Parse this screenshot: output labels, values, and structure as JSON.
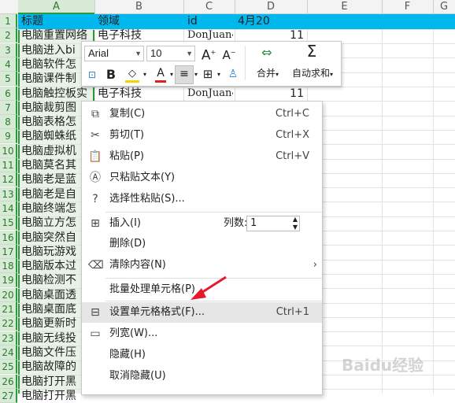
{
  "columns": [
    "A",
    "B",
    "C",
    "D",
    "E",
    "F",
    "G"
  ],
  "header_row": {
    "A": "标题",
    "B": "领域",
    "C": "id",
    "D": "4月20"
  },
  "rows": [
    {
      "n": "1"
    },
    {
      "n": "2",
      "a": "电脑重置网络",
      "b": "电子科技",
      "c": "DonJuan4",
      "d": "11"
    },
    {
      "n": "3",
      "a": "电脑进入bi"
    },
    {
      "n": "4",
      "a": "电脑软件怎"
    },
    {
      "n": "5",
      "a": "电脑课件制"
    },
    {
      "n": "6",
      "a": "电脑触控板实",
      "b": "电子科技",
      "c": "DonJuan4",
      "d": "11"
    },
    {
      "n": "7",
      "a": "电脑裁剪图"
    },
    {
      "n": "8",
      "a": "电脑表格怎"
    },
    {
      "n": "9",
      "a": "电脑蜘蛛纸"
    },
    {
      "n": "10",
      "a": "电脑虚拟机"
    },
    {
      "n": "11",
      "a": "电脑莫名其"
    },
    {
      "n": "12",
      "a": "电脑老是蓝"
    },
    {
      "n": "13",
      "a": "电脑老是自"
    },
    {
      "n": "14",
      "a": "电脑终端怎"
    },
    {
      "n": "15",
      "a": "电脑立方怎"
    },
    {
      "n": "16",
      "a": "电脑突然自"
    },
    {
      "n": "17",
      "a": "电脑玩游戏"
    },
    {
      "n": "18",
      "a": "电脑版本过"
    },
    {
      "n": "19",
      "a": "电脑检测不"
    },
    {
      "n": "20",
      "a": "电脑桌面透"
    },
    {
      "n": "21",
      "a": "电脑桌面底"
    },
    {
      "n": "22",
      "a": "电脑更新时"
    },
    {
      "n": "23",
      "a": "电脑无线投"
    },
    {
      "n": "24",
      "a": "电脑文件压"
    },
    {
      "n": "25",
      "a": "电脑故障的"
    },
    {
      "n": "26",
      "a": "电脑打开黑"
    },
    {
      "n": "27",
      "a": "电脑打开黑"
    }
  ],
  "mini_toolbar": {
    "font_name": "Arial",
    "font_size": "10",
    "grow_font": "A",
    "shrink_font": "A",
    "bold": "B",
    "fill_a": "A",
    "font_color_a": "A",
    "merge_label": "合并",
    "autosum_label": "自动求和"
  },
  "menu": {
    "copy": {
      "label": "复制(C)",
      "shortcut": "Ctrl+C"
    },
    "cut": {
      "label": "剪切(T)",
      "shortcut": "Ctrl+X"
    },
    "paste": {
      "label": "粘贴(P)",
      "shortcut": "Ctrl+V"
    },
    "paste_text": {
      "label": "只粘贴文本(Y)"
    },
    "paste_special": {
      "label": "选择性粘贴(S)..."
    },
    "insert": {
      "label": "插入(I)",
      "cols_label": "列数:",
      "cols_value": "1"
    },
    "delete": {
      "label": "删除(D)"
    },
    "clear": {
      "label": "清除内容(N)",
      "arrow": "›"
    },
    "batch": {
      "label": "批量处理单元格(P)"
    },
    "format": {
      "label": "设置单元格格式(F)...",
      "shortcut": "Ctrl+1"
    },
    "width": {
      "label": "列宽(W)..."
    },
    "hide": {
      "label": "隐藏(H)"
    },
    "unhide": {
      "label": "取消隐藏(U)"
    }
  },
  "annotation": {
    "color": "#e8182b"
  },
  "watermark": "Baidu经验"
}
